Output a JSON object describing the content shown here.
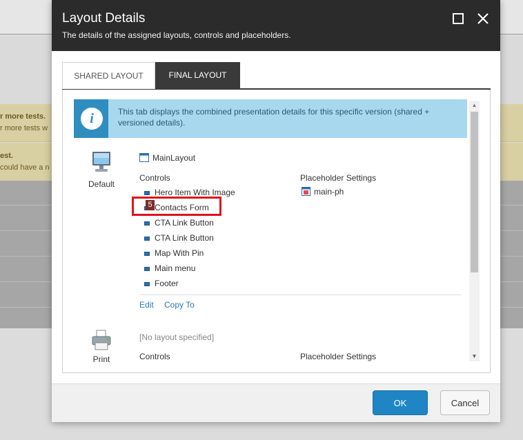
{
  "background": {
    "warning_lines": [
      "r more tests.",
      "r more tests w",
      "est.",
      "could have a n"
    ]
  },
  "dialog": {
    "title": "Layout Details",
    "subtitle": "The details of the assigned layouts, controls and placeholders.",
    "maximize_icon": "maximize-icon",
    "close_icon": "close-icon"
  },
  "tabs": [
    {
      "label": "SHARED LAYOUT",
      "active": false
    },
    {
      "label": "FINAL LAYOUT",
      "active": true
    }
  ],
  "info": {
    "icon": "info-icon",
    "text": "This tab displays the combined presentation details for this specific version (shared + versioned details)."
  },
  "default_device": {
    "label": "Default",
    "icon": "monitor-icon",
    "layout_name": "MainLayout",
    "controls_heading": "Controls",
    "controls": [
      "Hero Item With Image",
      "Contacts Form",
      "CTA Link Button",
      "CTA Link Button",
      "Map With Pin",
      "Main menu",
      "Footer"
    ],
    "placeholder_heading": "Placeholder Settings",
    "placeholder": "main-ph",
    "edit_label": "Edit",
    "copy_label": "Copy To"
  },
  "highlight_badge": "5",
  "print_device": {
    "label": "Print",
    "icon": "printer-icon",
    "layout_name": "[No layout specified]",
    "controls_heading": "Controls",
    "placeholder_heading": "Placeholder Settings"
  },
  "footer": {
    "ok_label": "OK",
    "cancel_label": "Cancel"
  },
  "colors": {
    "header_bg": "#2b2b2b",
    "info_bg": "#a8d8ee",
    "info_icon_bg": "#2f8ebf",
    "primary_button": "#1f85c4",
    "highlight": "#e0121a",
    "link": "#2a7ab0"
  }
}
